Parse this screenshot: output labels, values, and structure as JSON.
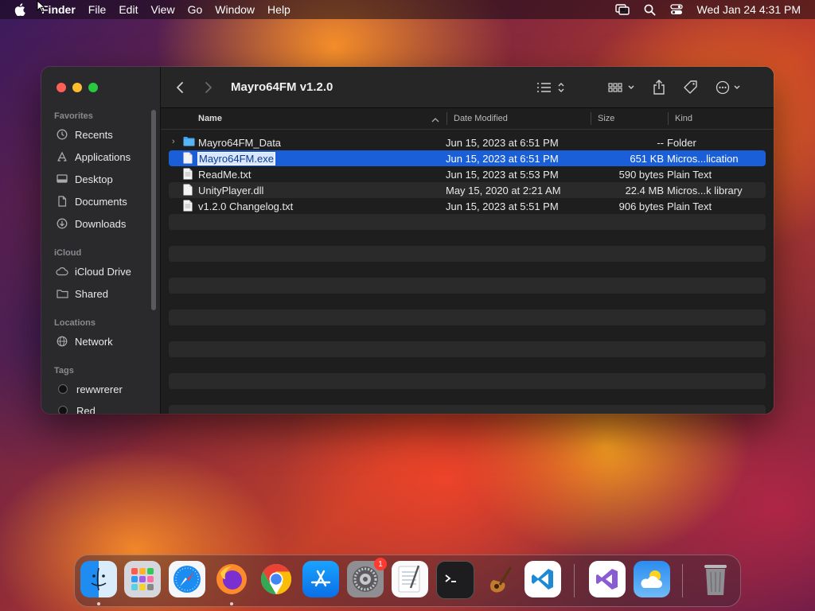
{
  "menubar": {
    "app": "Finder",
    "items": [
      "File",
      "Edit",
      "View",
      "Go",
      "Window",
      "Help"
    ],
    "clock": "Wed Jan 24  4:31 PM"
  },
  "window": {
    "title": "Mayro64FM v1.2.0",
    "sidebar": {
      "favorites_label": "Favorites",
      "favorites": [
        {
          "label": "Recents",
          "icon": "clock-icon"
        },
        {
          "label": "Applications",
          "icon": "applications-icon"
        },
        {
          "label": "Desktop",
          "icon": "desktop-icon"
        },
        {
          "label": "Documents",
          "icon": "document-icon"
        },
        {
          "label": "Downloads",
          "icon": "download-icon"
        }
      ],
      "icloud_label": "iCloud",
      "icloud": [
        {
          "label": "iCloud Drive",
          "icon": "cloud-icon"
        },
        {
          "label": "Shared",
          "icon": "shared-folder-icon"
        }
      ],
      "locations_label": "Locations",
      "locations": [
        {
          "label": "Network",
          "icon": "globe-icon"
        }
      ],
      "tags_label": "Tags",
      "tags": [
        {
          "label": "rewwrerer"
        },
        {
          "label": "Red"
        }
      ]
    },
    "columns": {
      "name": "Name",
      "date": "Date Modified",
      "size": "Size",
      "kind": "Kind"
    },
    "files": [
      {
        "name": "Mayro64FM_Data",
        "date": "Jun 15, 2023 at 6:51 PM",
        "size": "--",
        "kind": "Folder",
        "type": "folder"
      },
      {
        "name": "Mayro64FM.exe",
        "date": "Jun 15, 2023 at 6:51 PM",
        "size": "651 KB",
        "kind": "Micros...lication",
        "type": "file",
        "selected": true
      },
      {
        "name": "ReadMe.txt",
        "date": "Jun 15, 2023 at 5:53 PM",
        "size": "590 bytes",
        "kind": "Plain Text",
        "type": "text"
      },
      {
        "name": "UnityPlayer.dll",
        "date": "May 15, 2020 at 2:21 AM",
        "size": "22.4 MB",
        "kind": "Micros...k library",
        "type": "file"
      },
      {
        "name": "v1.2.0 Changelog.txt",
        "date": "Jun 15, 2023 at 5:51 PM",
        "size": "906 bytes",
        "kind": "Plain Text",
        "type": "text"
      }
    ]
  },
  "dock": {
    "apps": [
      "Finder",
      "Launchpad",
      "Safari",
      "Firefox",
      "Chrome",
      "App Store",
      "System Settings",
      "TextEdit",
      "Terminal",
      "GarageBand",
      "Visual Studio Code",
      "Visual Studio",
      "Weather",
      "Trash"
    ],
    "settings_badge": "1"
  }
}
